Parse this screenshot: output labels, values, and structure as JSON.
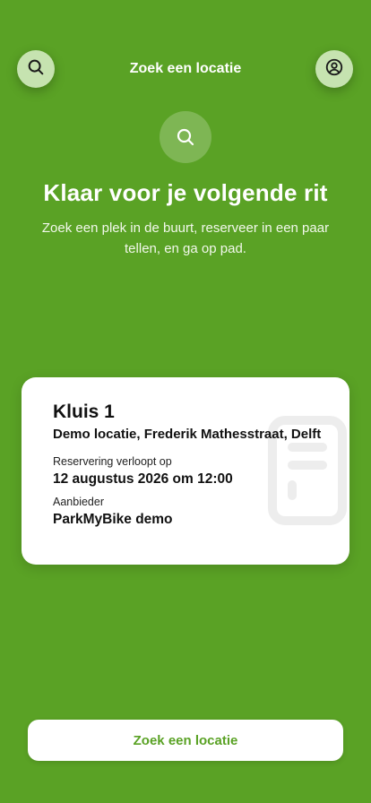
{
  "header": {
    "title": "Zoek een locatie",
    "left_icon": "search-icon",
    "right_icon": "user-circle-icon"
  },
  "hero": {
    "icon": "search-icon",
    "title": "Klaar voor je volgende rit",
    "subtitle": "Zoek een plek in de buurt, reserveer in een paar tellen, en ga op pad."
  },
  "reservation_card": {
    "title": "Kluis 1",
    "address": "Demo locatie, Frederik Mathesstraat, Delft",
    "expires_label": "Reservering verloopt op",
    "expires_value": "12 augustus 2026 om 12:00",
    "provider_label": "Aanbieder",
    "provider_value": "ParkMyBike demo",
    "watermark_icon": "locker-icon"
  },
  "bottom_button": {
    "label": "Zoek een locatie"
  },
  "colors": {
    "background": "#5aa225",
    "button_circle": "#c6e3b0",
    "card": "#ffffff",
    "accent_text": "#5aa225"
  }
}
